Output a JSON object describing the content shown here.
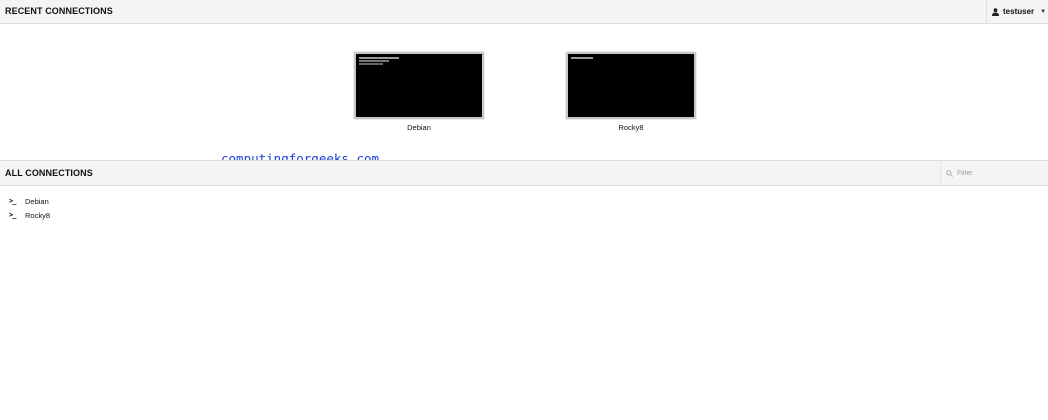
{
  "recent": {
    "title": "RECENT CONNECTIONS",
    "items": [
      {
        "label": "Debian",
        "icon": "terminal-screen-thumbnail"
      },
      {
        "label": "Rocky8",
        "icon": "terminal-screen-thumbnail"
      }
    ]
  },
  "user_menu": {
    "username": "testuser",
    "icon": "user-icon"
  },
  "watermark": "computingforgeeks.com",
  "all": {
    "title": "ALL CONNECTIONS",
    "filter_placeholder": "Filter",
    "items": [
      {
        "label": "Debian",
        "icon": "terminal-icon"
      },
      {
        "label": "Rocky8",
        "icon": "terminal-icon"
      }
    ]
  },
  "colors": {
    "header_bg": "#f4f4f4",
    "border": "#dedede",
    "thumbnail_bg": "#000000",
    "watermark": "#1a3fd6"
  }
}
